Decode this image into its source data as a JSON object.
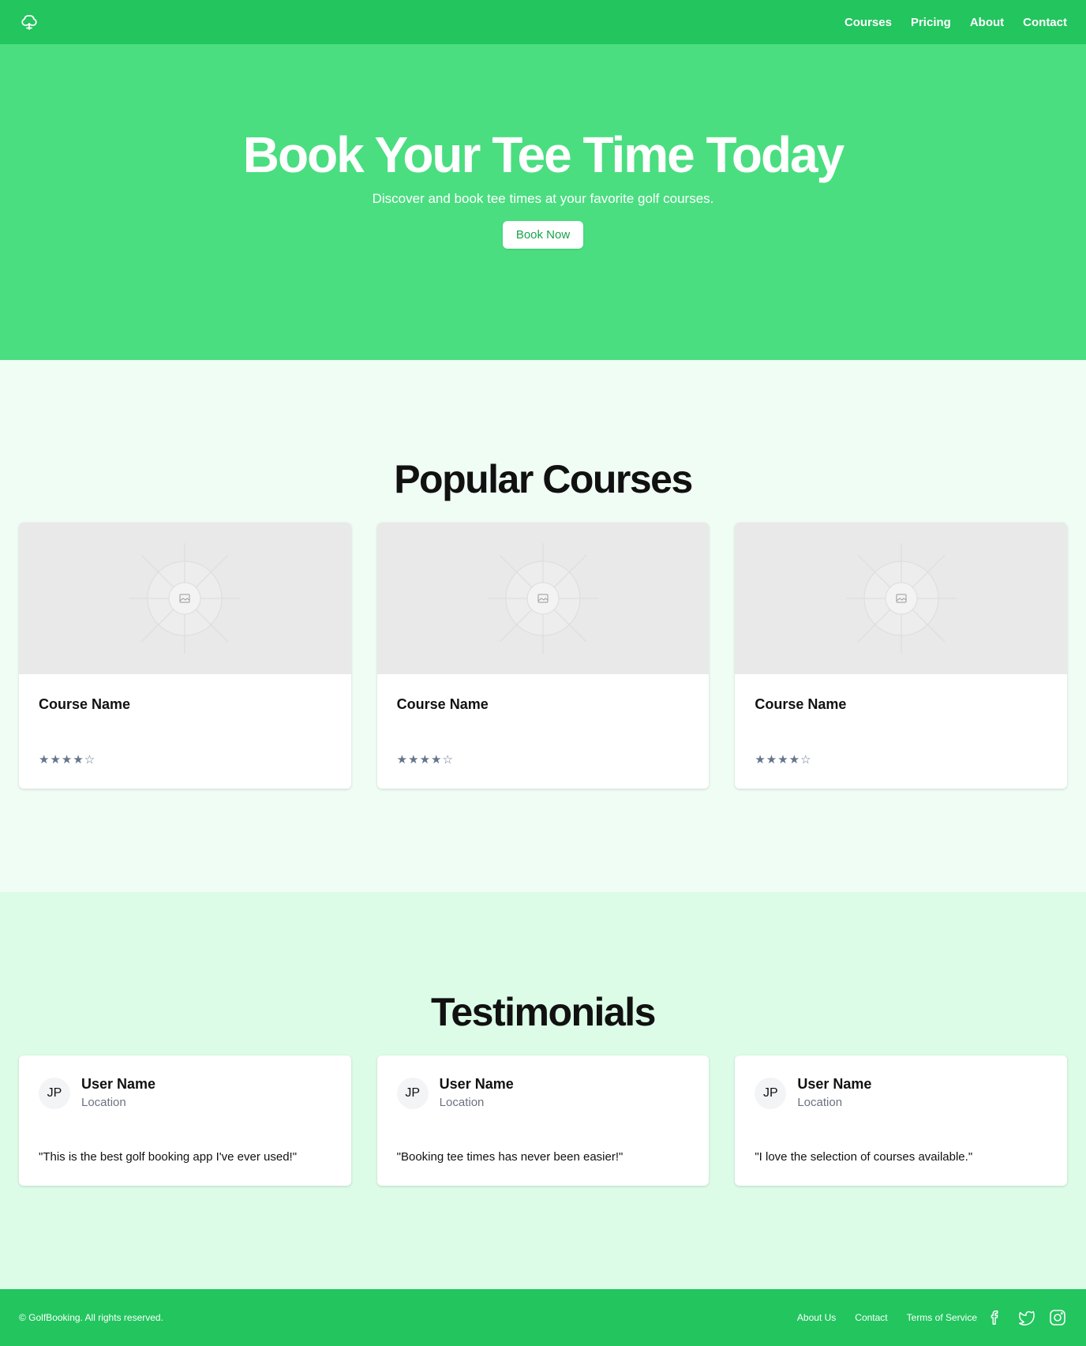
{
  "header": {
    "logo": "leaf-icon",
    "nav": [
      {
        "label": "Courses"
      },
      {
        "label": "Pricing"
      },
      {
        "label": "About"
      },
      {
        "label": "Contact"
      }
    ]
  },
  "hero": {
    "title": "Book Your Tee Time Today",
    "subtitle": "Discover and book tee times at your favorite golf courses.",
    "cta": "Book Now"
  },
  "courses": {
    "title": "Popular Courses",
    "items": [
      {
        "name": "Course Name",
        "rating": 4,
        "stars": "★★★★☆"
      },
      {
        "name": "Course Name",
        "rating": 4,
        "stars": "★★★★☆"
      },
      {
        "name": "Course Name",
        "rating": 4,
        "stars": "★★★★☆"
      }
    ]
  },
  "testimonials": {
    "title": "Testimonials",
    "items": [
      {
        "initials": "JP",
        "name": "User Name",
        "location": "Location",
        "quote": "\"This is the best golf booking app I've ever used!\""
      },
      {
        "initials": "JP",
        "name": "User Name",
        "location": "Location",
        "quote": "\"Booking tee times has never been easier!\""
      },
      {
        "initials": "JP",
        "name": "User Name",
        "location": "Location",
        "quote": "\"I love the selection of courses available.\""
      }
    ]
  },
  "footer": {
    "copyright": "© GolfBooking. All rights reserved.",
    "links": [
      {
        "label": "About Us"
      },
      {
        "label": "Contact"
      },
      {
        "label": "Terms of Service"
      }
    ],
    "social": [
      "facebook-icon",
      "twitter-icon",
      "instagram-icon"
    ]
  },
  "colors": {
    "nav": "#22c55e",
    "hero": "#4ade80",
    "courses_bg": "#f0fdf4",
    "testimonials_bg": "#dcfce7",
    "cta_text": "#16a34a"
  }
}
